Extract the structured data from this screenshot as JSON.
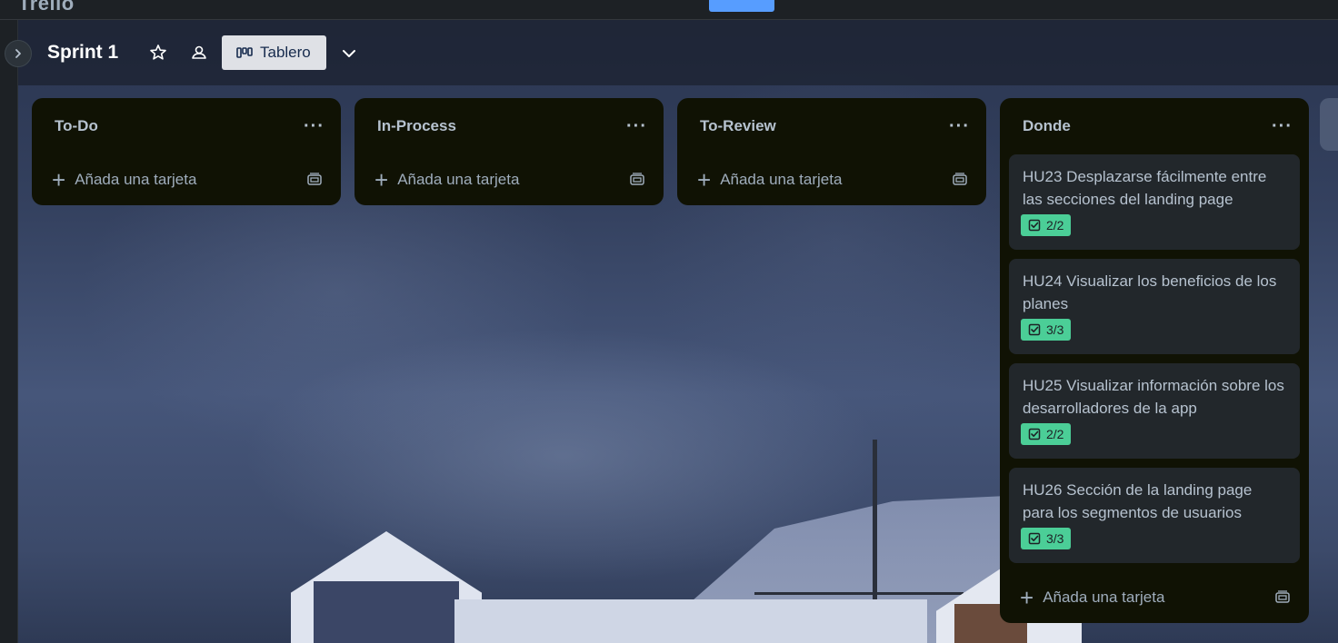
{
  "app": {
    "logo": "Trello",
    "accent": "#579dff"
  },
  "board": {
    "title": "Sprint 1",
    "view_label": "Tablero",
    "icons": [
      "star-icon",
      "people-icon",
      "board-view-icon",
      "chevron-down-icon"
    ]
  },
  "lists": [
    {
      "title": "To-Do",
      "add_label": "Añada una tarjeta",
      "cards": []
    },
    {
      "title": "In-Process",
      "add_label": "Añada una tarjeta",
      "cards": []
    },
    {
      "title": "To-Review",
      "add_label": "Añada una tarjeta",
      "cards": []
    },
    {
      "title": "Donde",
      "add_label": "Añada una tarjeta",
      "cards": [
        {
          "title": "HU23 Desplazarse fácilmente entre las secciones del landing page",
          "checklist": "2/2"
        },
        {
          "title": "HU24 Visualizar los beneficios de los planes",
          "checklist": "3/3"
        },
        {
          "title": "HU25 Visualizar información sobre los desarrolladores de la app",
          "checklist": "2/2"
        },
        {
          "title": "HU26 Sección de la landing page para los segmentos de usuarios",
          "checklist": "3/3"
        }
      ]
    }
  ],
  "colors": {
    "list_bg": "#101204",
    "card_bg": "#22272b",
    "badge_complete": "#4bce97"
  }
}
